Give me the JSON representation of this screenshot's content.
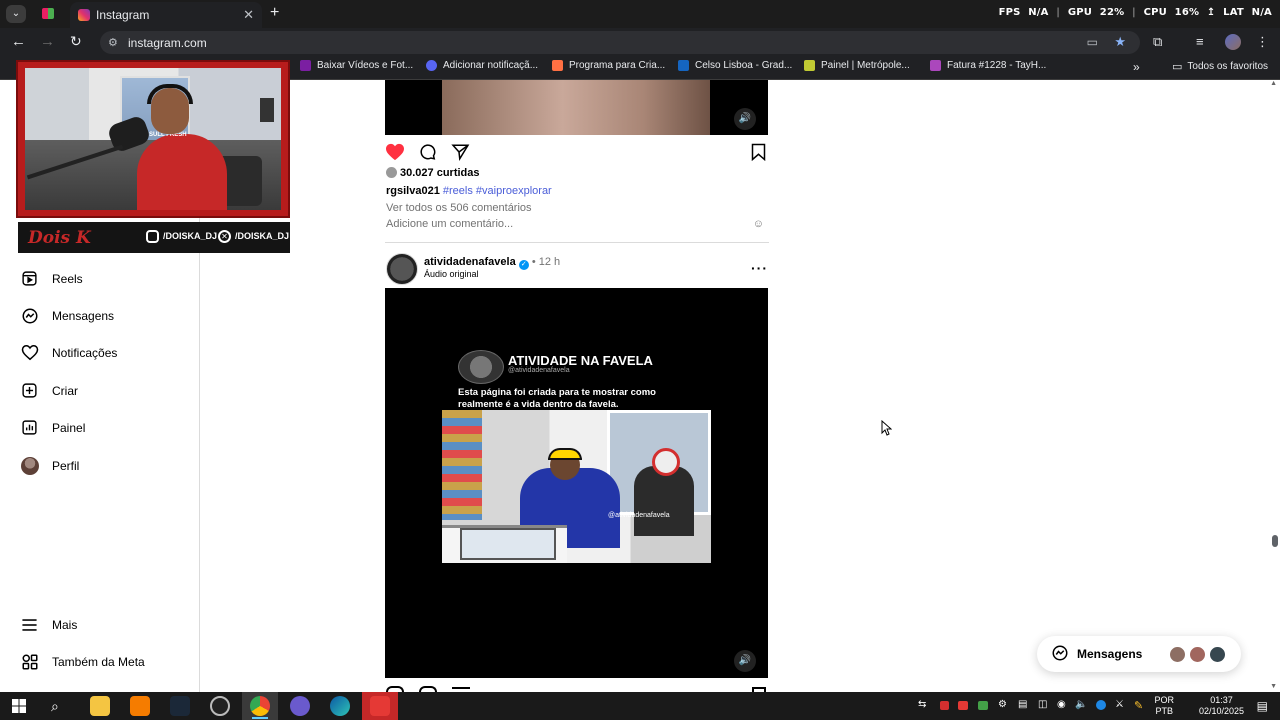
{
  "browser": {
    "tab_title": "Instagram",
    "url": "instagram.com",
    "stats": {
      "fps_label": "FPS",
      "fps_value": "N/A",
      "gpu_label": "GPU",
      "gpu_value": "22%",
      "cpu_label": "CPU",
      "cpu_value": "16%",
      "lat_label": "LAT",
      "lat_value": "N/A"
    },
    "bookmarks": [
      {
        "label": "Baixar Vídeos e Fot...",
        "color": "#7b1fa2"
      },
      {
        "label": "Adicionar notificaçã...",
        "color": "#5865f2"
      },
      {
        "label": "Programa para Cria...",
        "color": "#ff7043"
      },
      {
        "label": "Celso Lisboa - Grad...",
        "color": "#1565c0"
      },
      {
        "label": "Painel | Metrópole...",
        "color": "#c0ca33"
      },
      {
        "label": "Fatura #1228 - TayH...",
        "color": "#ab47bc"
      }
    ],
    "favorites_label": "Todos os favoritos"
  },
  "webcam": {
    "logo_text": "Dois K",
    "handle_instagram": "/DOISKA_DJ",
    "handle_x": "/DOISKA_DJ"
  },
  "sidebar": {
    "items": [
      {
        "label": "Reels",
        "icon": "reels-icon"
      },
      {
        "label": "Mensagens",
        "icon": "messenger-icon"
      },
      {
        "label": "Notificações",
        "icon": "heart-icon"
      },
      {
        "label": "Criar",
        "icon": "plus-square-icon"
      },
      {
        "label": "Painel",
        "icon": "chart-icon"
      },
      {
        "label": "Perfil",
        "icon": "avatar-icon"
      }
    ],
    "more_label": "Mais",
    "meta_label": "Também da Meta"
  },
  "post1": {
    "likes": "30.027 curtidas",
    "username": "rgsilva021",
    "hashtags": "#reels #vaiproexplorar",
    "view_comments": "Ver todos os 506 comentários",
    "add_comment": "Adicione um comentário..."
  },
  "post2": {
    "username": "atividadenafavela",
    "time": "12 h",
    "audio": "Áudio original",
    "overlay_title": "ATIVIDADE NA FAVELA",
    "overlay_handle": "@atividadenafavela",
    "overlay_caption_1": "Esta página foi criada para te mostrar como",
    "overlay_caption_2": "realmente é a vida dentro da favela.",
    "watermark": "@atividadenafavela"
  },
  "messages_pill": {
    "label": "Mensagens"
  },
  "taskbar": {
    "lang_1": "POR",
    "lang_2": "PTB",
    "time": "01:37",
    "date": "02/10/2025"
  },
  "colors": {
    "like_red": "#ff3040",
    "verified_blue": "#0095f6",
    "hashtag_blue": "#4a5dd8"
  }
}
